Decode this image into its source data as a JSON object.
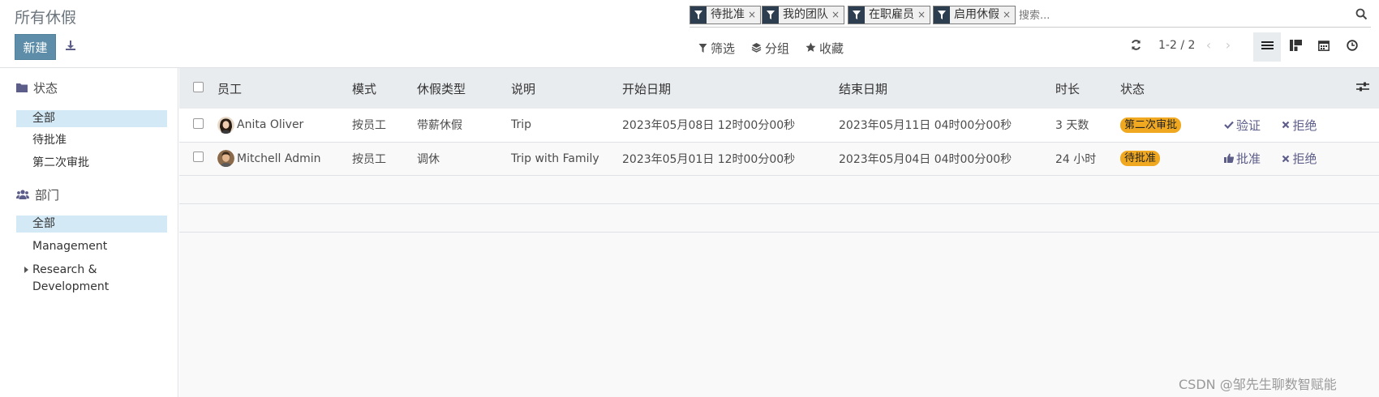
{
  "header": {
    "title": "所有休假",
    "new_label": "新建"
  },
  "search": {
    "facets": [
      "待批准",
      "我的团队",
      "在职雇员",
      "启用休假"
    ],
    "facet_remove": "×",
    "placeholder": "搜索..."
  },
  "toolbar": {
    "filter_label": "筛选",
    "group_label": "分组",
    "favorites_label": "收藏"
  },
  "pager": {
    "value": "1-2 / 2",
    "prev": "‹",
    "next": "›"
  },
  "sidebar": {
    "status_title": "状态",
    "status_items": [
      "全部",
      "待批准",
      "第二次审批"
    ],
    "dept_title": "部门",
    "dept_items": [
      "全部",
      "Management",
      "Research & Development"
    ]
  },
  "table": {
    "columns": [
      "员工",
      "模式",
      "休假类型",
      "说明",
      "开始日期",
      "结束日期",
      "时长",
      "状态"
    ],
    "rows": [
      {
        "employee": "Anita Oliver",
        "mode": "按员工",
        "type": "带薪休假",
        "description": "Trip",
        "start": "2023年05月08日 12时00分00秒",
        "end": "2023年05月11日 04时00分00秒",
        "duration": "3 天数",
        "status": "第二次审批",
        "action1": "验证",
        "action2": "拒绝"
      },
      {
        "employee": "Mitchell Admin",
        "mode": "按员工",
        "type": "调休",
        "description": "Trip with Family",
        "start": "2023年05月01日 12时00分00秒",
        "end": "2023年05月04日 04时00分00秒",
        "duration": "24 小时",
        "status": "待批准",
        "action1": "批准",
        "action2": "拒绝"
      }
    ]
  },
  "colors": {
    "primary": "#5d8da8",
    "badge": "#f0a820",
    "facet_icon_bg": "#2c3e50",
    "sidebar_active": "#d3e9f6",
    "action": "#5d5d8a"
  },
  "watermark": "CSDN @邹先生聊数智赋能"
}
